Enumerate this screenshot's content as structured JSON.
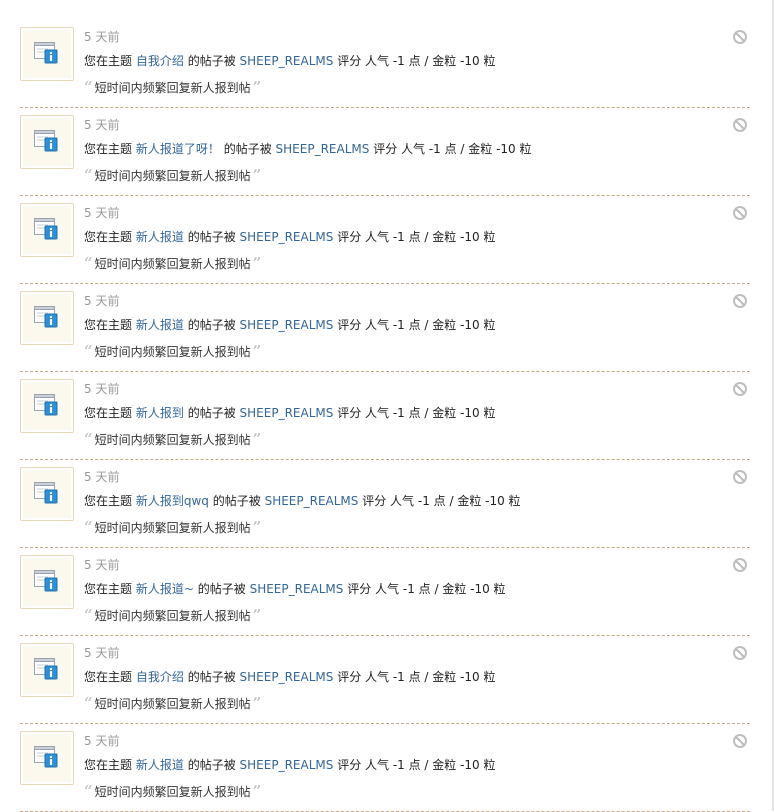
{
  "notifications": [
    {
      "time": "5 天前",
      "prefix": "您在主题",
      "thread": "自我介绍",
      "mid": "的帖子被",
      "user": "SHEEP_REALMS",
      "action": "评分 人气 -1 点 / 金粒 -10 粒",
      "reason": "短时间内频繁回复新人报到帖"
    },
    {
      "time": "5 天前",
      "prefix": "您在主题",
      "thread": "新人报道了呀！",
      "mid": "的帖子被",
      "user": "SHEEP_REALMS",
      "action": "评分 人气 -1 点 / 金粒 -10 粒",
      "reason": "短时间内频繁回复新人报到帖"
    },
    {
      "time": "5 天前",
      "prefix": "您在主题",
      "thread": "新人报道",
      "mid": "的帖子被",
      "user": "SHEEP_REALMS",
      "action": "评分 人气 -1 点 / 金粒 -10 粒",
      "reason": "短时间内频繁回复新人报到帖"
    },
    {
      "time": "5 天前",
      "prefix": "您在主题",
      "thread": "新人报道",
      "mid": "的帖子被",
      "user": "SHEEP_REALMS",
      "action": "评分 人气 -1 点 / 金粒 -10 粒",
      "reason": "短时间内频繁回复新人报到帖"
    },
    {
      "time": "5 天前",
      "prefix": "您在主题",
      "thread": "新人报到",
      "mid": "的帖子被",
      "user": "SHEEP_REALMS",
      "action": "评分 人气 -1 点 / 金粒 -10 粒",
      "reason": "短时间内频繁回复新人报到帖"
    },
    {
      "time": "5 天前",
      "prefix": "您在主题",
      "thread": "新人报到qwq",
      "mid": "的帖子被",
      "user": "SHEEP_REALMS",
      "action": "评分 人气 -1 点 / 金粒 -10 粒",
      "reason": "短时间内频繁回复新人报到帖"
    },
    {
      "time": "5 天前",
      "prefix": "您在主题",
      "thread": "新人报道~",
      "mid": "的帖子被",
      "user": "SHEEP_REALMS",
      "action": "评分 人气 -1 点 / 金粒 -10 粒",
      "reason": "短时间内频繁回复新人报到帖"
    },
    {
      "time": "5 天前",
      "prefix": "您在主题",
      "thread": "自我介绍",
      "mid": "的帖子被",
      "user": "SHEEP_REALMS",
      "action": "评分 人气 -1 点 / 金粒 -10 粒",
      "reason": "短时间内频繁回复新人报到帖"
    },
    {
      "time": "5 天前",
      "prefix": "您在主题",
      "thread": "新人报道",
      "mid": "的帖子被",
      "user": "SHEEP_REALMS",
      "action": "评分 人气 -1 点 / 金粒 -10 粒",
      "reason": "短时间内频繁回复新人报到帖"
    }
  ],
  "quotes": {
    "open": "“",
    "close": "”"
  },
  "icons": {
    "avatar": "system-notice-icon",
    "dismiss": "ban-icon"
  },
  "colors": {
    "link": "#336699",
    "time": "#999999",
    "divider": "#c9a884"
  }
}
